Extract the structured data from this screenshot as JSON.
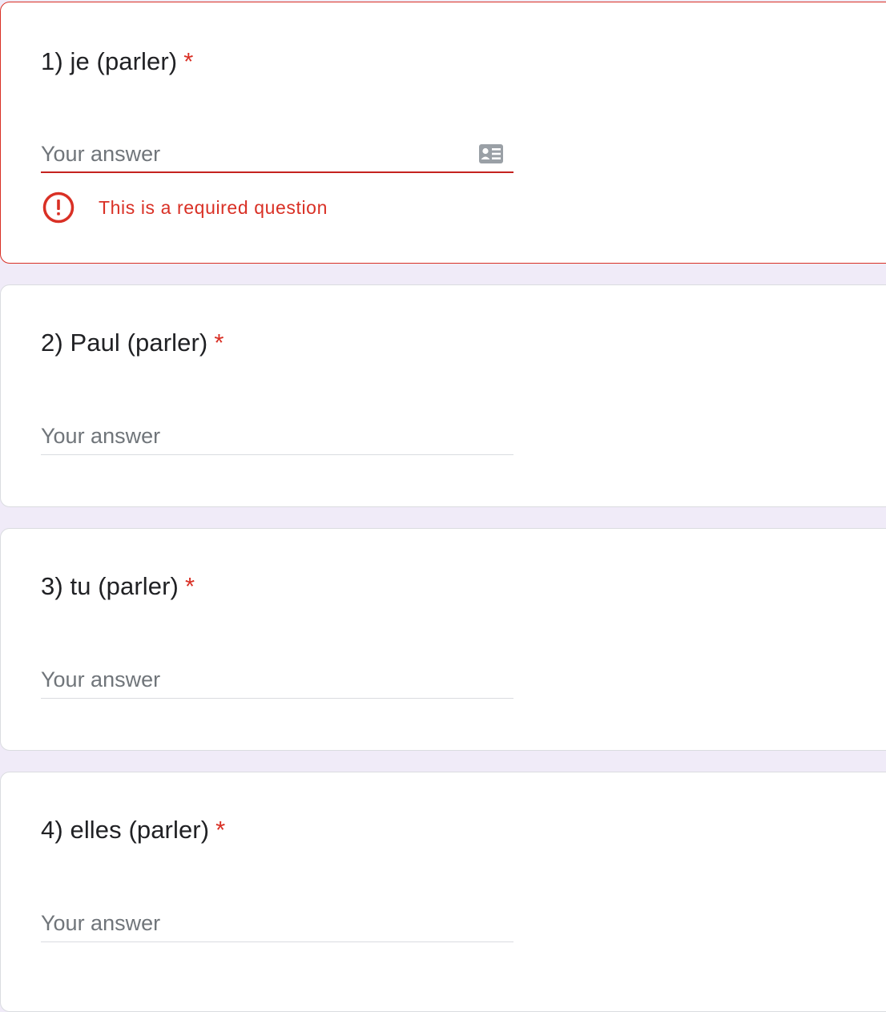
{
  "questions": [
    {
      "number_title": "1) je (parler)",
      "required_mark": "*",
      "placeholder": "Your answer",
      "error": "This is a required question"
    },
    {
      "number_title": "2) Paul (parler)",
      "required_mark": "*",
      "placeholder": "Your answer"
    },
    {
      "number_title": "3) tu (parler)",
      "required_mark": "*",
      "placeholder": "Your answer"
    },
    {
      "number_title": "4) elles (parler)",
      "required_mark": "*",
      "placeholder": "Your answer"
    }
  ],
  "colors": {
    "page_background": "#f0ebf8",
    "card_background": "#ffffff",
    "error_red": "#d93025",
    "placeholder_gray": "#70757a"
  },
  "icons": {
    "autofill": "contact-card-icon",
    "error": "error-exclamation-icon"
  }
}
